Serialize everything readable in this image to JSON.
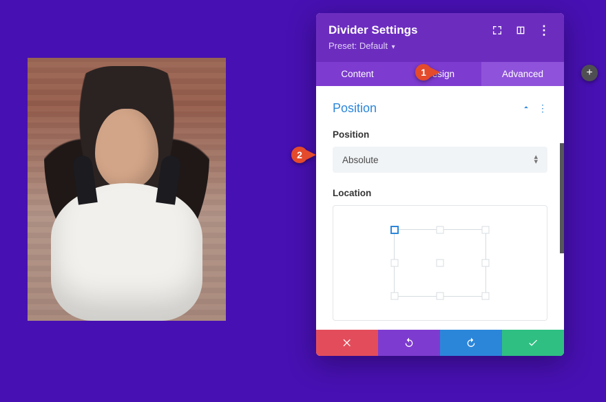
{
  "panel": {
    "title": "Divider Settings",
    "preset_label": "Preset:",
    "preset_value": "Default"
  },
  "tabs": {
    "content": "Content",
    "design": "Design",
    "advanced": "Advanced"
  },
  "section": {
    "title": "Position"
  },
  "fields": {
    "position_label": "Position",
    "position_value": "Absolute",
    "location_label": "Location"
  },
  "annotations": {
    "step1": "1",
    "step2": "2"
  },
  "icons": {
    "add": "+"
  }
}
